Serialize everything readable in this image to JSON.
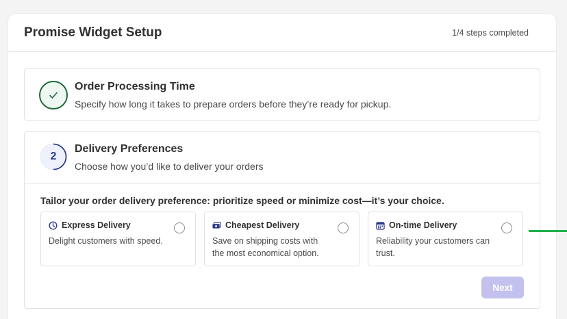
{
  "header": {
    "title": "Promise Widget Setup",
    "steps_completed": "1/4 steps completed"
  },
  "steps": [
    {
      "status": "completed",
      "icon": "check-icon",
      "title": "Order Processing Time",
      "description": "Specify how long it takes to prepare orders before they’re ready for pickup."
    },
    {
      "status": "current",
      "number": "2",
      "title": "Delivery Preferences",
      "description": "Choose how you’d like to deliver your orders"
    }
  ],
  "delivery": {
    "prompt": "Tailor your order delivery preference: prioritize speed or minimize cost—it’s your choice.",
    "options": [
      {
        "icon": "clock-icon",
        "title": "Express Delivery",
        "description": "Delight customers with speed.",
        "selected": false
      },
      {
        "icon": "cash-icon",
        "title": "Cheapest Delivery",
        "description": "Save on shipping costs with the most economical option.",
        "selected": false
      },
      {
        "icon": "calendar-icon",
        "title": "On-time Delivery",
        "description": "Reliability your customers can trust.",
        "selected": false
      }
    ],
    "next_label": "Next"
  },
  "colors": {
    "completed_green": "#1f6b3b",
    "step_blue": "#2a3a8c",
    "next_disabled": "#c3c1ee",
    "connector_green": "#22b14c"
  }
}
